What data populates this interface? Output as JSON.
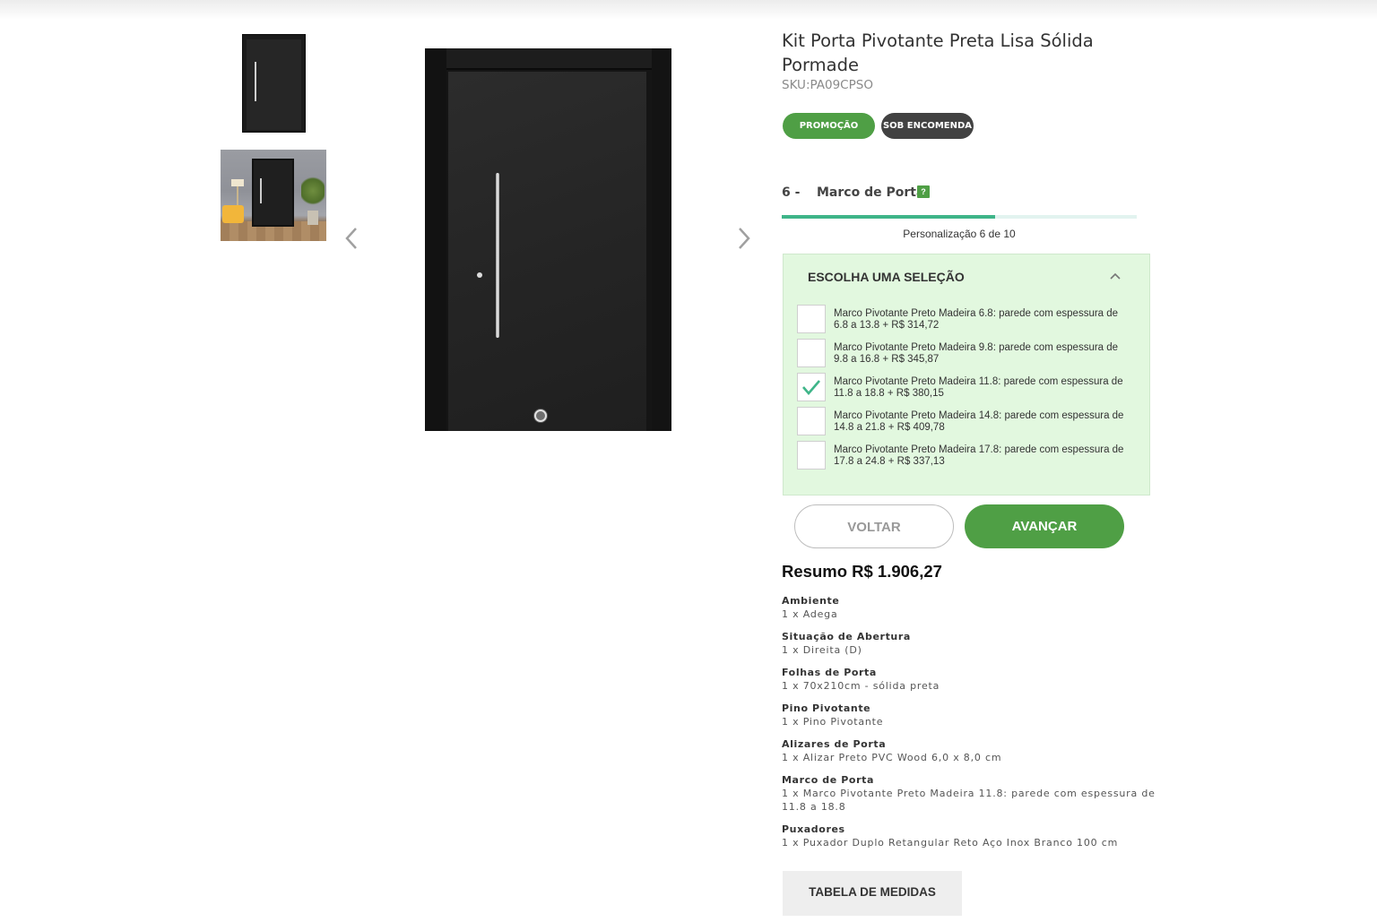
{
  "product": {
    "title": "Kit Porta Pivotante Preta Lisa Sólida Pormade",
    "sku": "SKU:PA09CPSO",
    "badges": [
      "PROMOÇÃO",
      "SOB ENCOMENDA"
    ]
  },
  "gallery": {
    "thumbnails": [
      "door-front-thumbnail",
      "door-room-thumbnail"
    ],
    "prev_icon": "chevron-left-icon",
    "next_icon": "chevron-right-icon"
  },
  "step": {
    "number": "6 -",
    "name": "Marco de Porta",
    "help": "?",
    "progress_text": "Personalização 6 de 10",
    "progress_fraction": 0.6
  },
  "selection": {
    "title": "ESCOLHA UMA SELEÇÃO",
    "options": [
      {
        "label": "Marco Pivotante Preto Madeira 6.8: parede com espessura de 6.8 a 13.8 + R$ 314,72",
        "checked": false
      },
      {
        "label": "Marco Pivotante Preto Madeira 9.8: parede com espessura de 9.8 a 16.8 + R$ 345,87",
        "checked": false
      },
      {
        "label": "Marco Pivotante Preto Madeira 11.8: parede com espessura de 11.8 a 18.8 + R$ 380,15",
        "checked": true
      },
      {
        "label": "Marco Pivotante Preto Madeira 14.8: parede com espessura de 14.8 a 21.8 + R$ 409,78",
        "checked": false
      },
      {
        "label": "Marco Pivotante Preto Madeira 17.8: parede com espessura de 17.8 a 24.8 + R$ 337,13",
        "checked": false
      }
    ]
  },
  "buttons": {
    "back": "VOLTAR",
    "next": "AVANÇAR",
    "table": "TABELA DE MEDIDAS"
  },
  "summary": {
    "title": "Resumo R$ 1.906,27",
    "items": [
      {
        "label": "Ambiente",
        "value": "1 x Adega"
      },
      {
        "label": "Situação de Abertura",
        "value": "1 x Direita (D)"
      },
      {
        "label": "Folhas de Porta",
        "value": "1 x 70x210cm - sólida preta"
      },
      {
        "label": "Pino Pivotante",
        "value": "1 x Pino Pivotante"
      },
      {
        "label": "Alizares de Porta",
        "value": "1 x Alizar Preto PVC Wood 6,0 x 8,0 cm"
      },
      {
        "label": "Marco de Porta",
        "value": "1 x Marco Pivotante Preto Madeira 11.8: parede com espessura de 11.8 a 18.8"
      },
      {
        "label": "Puxadores",
        "value": "1 x Puxador Duplo Retangular Reto Aço Inox Branco 100 cm"
      }
    ]
  },
  "colors": {
    "accent_green": "#4f9f45",
    "progress_green": "#3fb589",
    "selection_bg": "#e2f8df",
    "dark_badge": "#424242"
  }
}
